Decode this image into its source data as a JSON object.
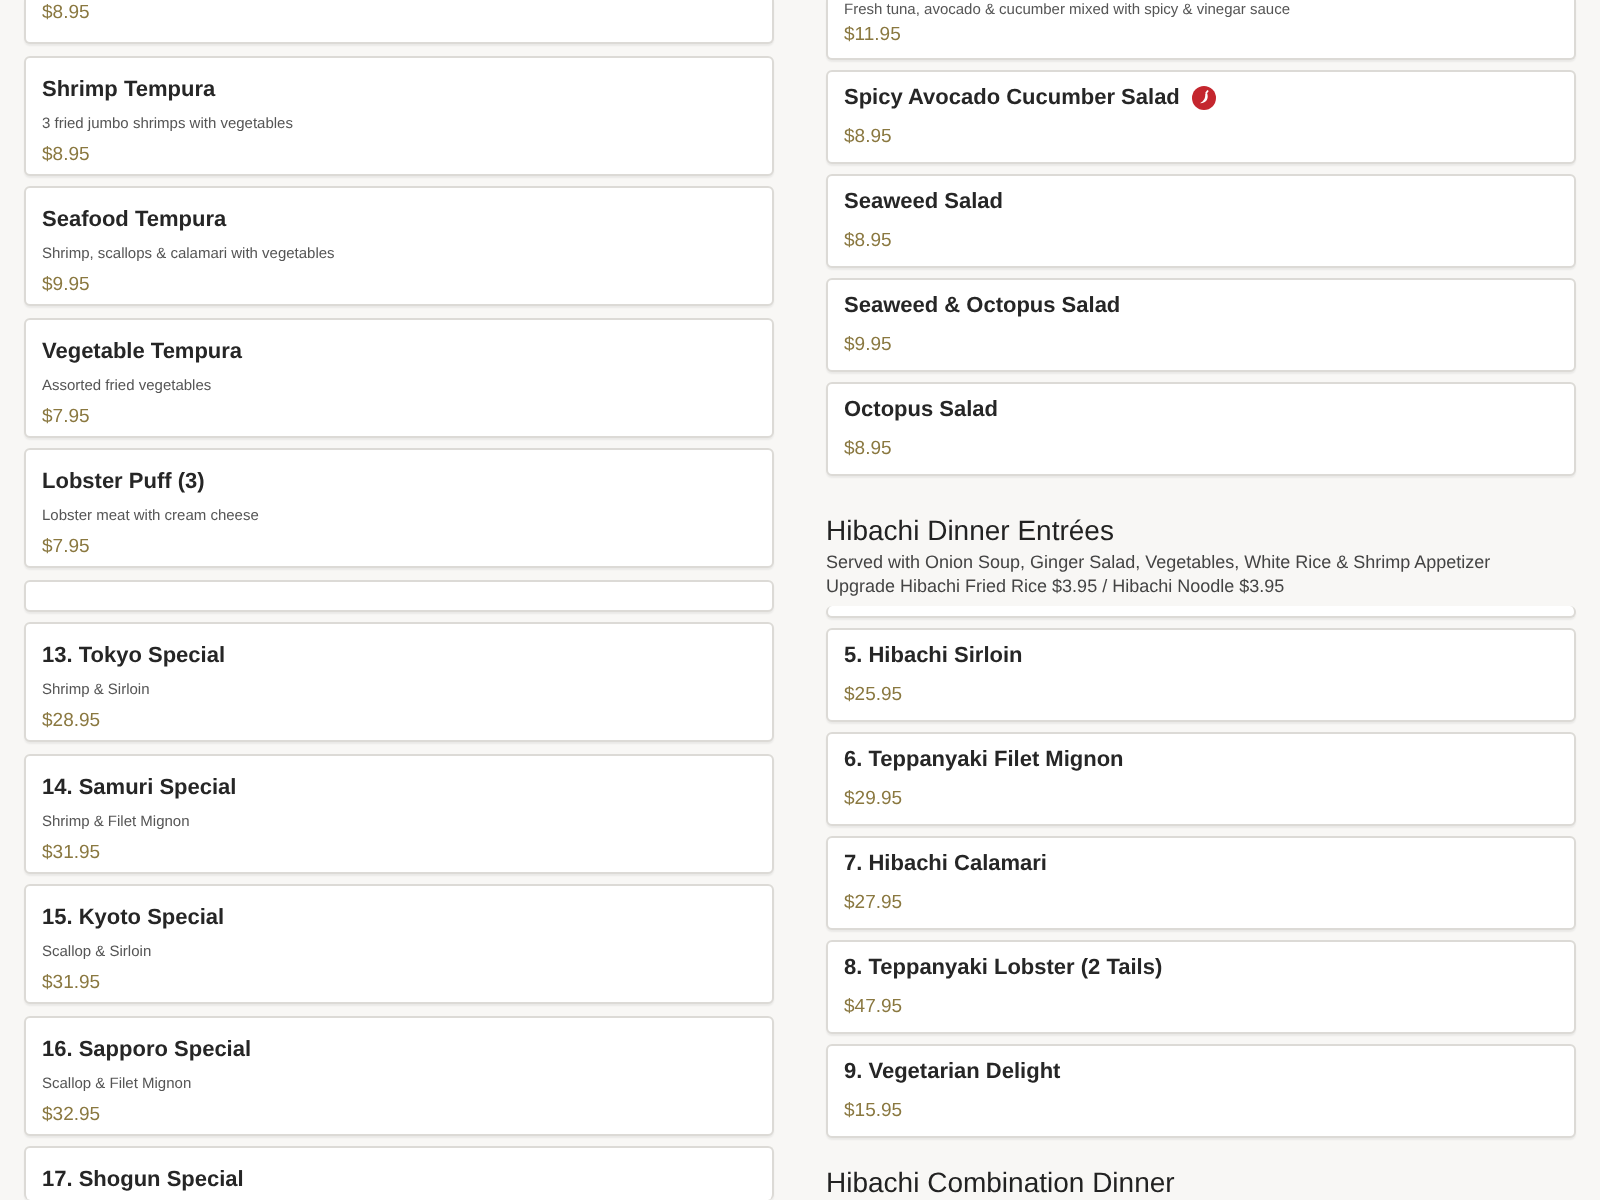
{
  "columns": [
    {
      "blocks": [
        {
          "kind": "item",
          "price": "$8.95"
        },
        {
          "kind": "item",
          "name": "Shrimp Tempura",
          "description": "3 fried jumbo shrimps with vegetables",
          "price": "$8.95"
        },
        {
          "kind": "item",
          "name": "Seafood Tempura",
          "description": "Shrimp, scallops & calamari with vegetables",
          "price": "$9.95"
        },
        {
          "kind": "item",
          "name": "Vegetable Tempura",
          "description": "Assorted fried vegetables",
          "price": "$7.95"
        },
        {
          "kind": "item",
          "name": "Lobster Puff (3)",
          "description": "Lobster meat with cream cheese",
          "price": "$7.95"
        },
        {
          "kind": "clipped"
        },
        {
          "kind": "item",
          "name": "13. Tokyo Special",
          "description": "Shrimp & Sirloin",
          "price": "$28.95"
        },
        {
          "kind": "item",
          "name": "14. Samuri Special",
          "description": "Shrimp & Filet Mignon",
          "price": "$31.95"
        },
        {
          "kind": "item",
          "name": "15. Kyoto Special",
          "description": "Scallop & Sirloin",
          "price": "$31.95"
        },
        {
          "kind": "item",
          "name": "16. Sapporo Special",
          "description": "Scallop & Filet Mignon",
          "price": "$32.95"
        },
        {
          "kind": "item",
          "name": "17. Shogun Special"
        }
      ]
    },
    {
      "blocks": [
        {
          "kind": "item",
          "description": "Fresh tuna, avocado & cucumber mixed with spicy & vinegar sauce",
          "price": "$11.95",
          "spicy": false
        },
        {
          "kind": "item",
          "name": "Spicy Avocado Cucumber Salad",
          "price": "$8.95",
          "spicy": true
        },
        {
          "kind": "item",
          "name": "Seaweed Salad",
          "price": "$8.95",
          "spicy": false
        },
        {
          "kind": "item",
          "name": "Seaweed & Octopus Salad",
          "price": "$9.95",
          "spicy": false
        },
        {
          "kind": "item",
          "name": "Octopus Salad",
          "price": "$8.95",
          "spicy": false
        },
        {
          "kind": "heading",
          "title": "Hibachi Dinner Entrées",
          "notes": [
            "Served with Onion Soup, Ginger Salad, Vegetables, White Rice & Shrimp Appetizer",
            "Upgrade Hibachi Fried Rice $3.95 / Hibachi Noodle $3.95"
          ]
        },
        {
          "kind": "clipped"
        },
        {
          "kind": "item",
          "name": "5. Hibachi Sirloin",
          "price": "$25.95",
          "spicy": false
        },
        {
          "kind": "item",
          "name": "6. Teppanyaki Filet Mignon",
          "price": "$29.95",
          "spicy": false
        },
        {
          "kind": "item",
          "name": "7. Hibachi Calamari",
          "price": "$27.95",
          "spicy": false
        },
        {
          "kind": "item",
          "name": "8. Teppanyaki Lobster (2 Tails)",
          "price": "$47.95",
          "spicy": false
        },
        {
          "kind": "item",
          "name": "9. Vegetarian Delight",
          "price": "$15.95",
          "spicy": false
        },
        {
          "kind": "heading",
          "title": "Hibachi Combination Dinner"
        }
      ]
    }
  ]
}
